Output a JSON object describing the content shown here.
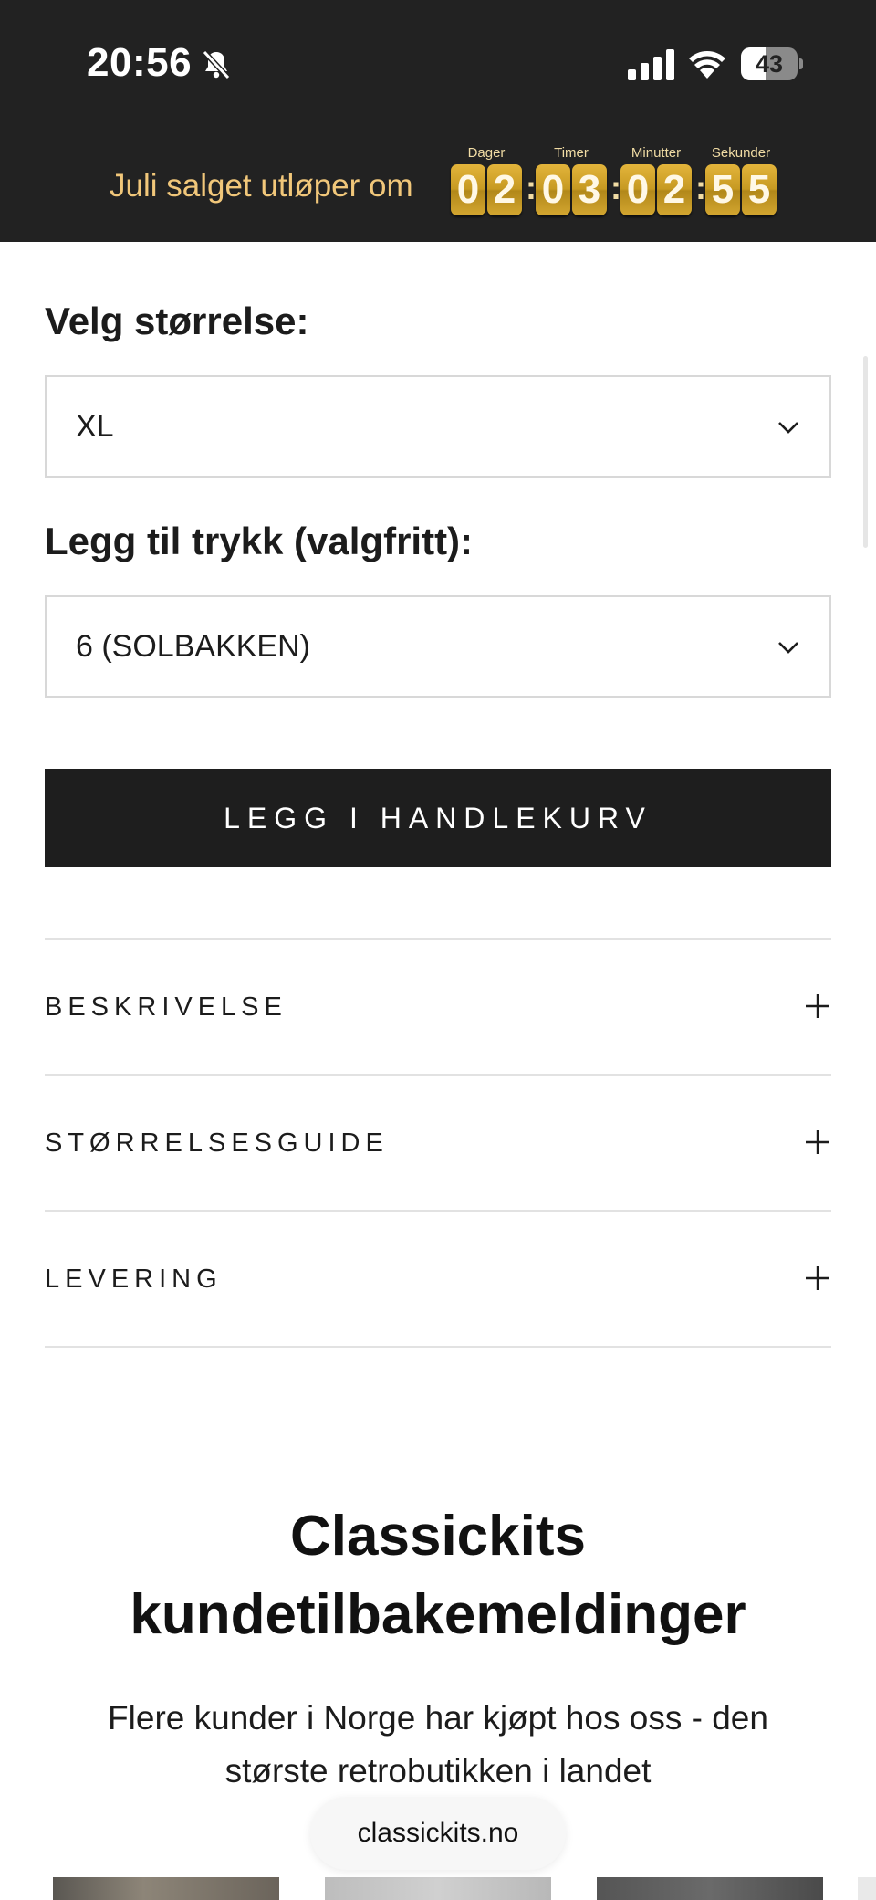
{
  "status_bar": {
    "time": "20:56",
    "battery_level": "43",
    "battery_fraction": 0.43,
    "icons": [
      "bell-muted-icon",
      "cellular-signal-icon",
      "wifi-icon",
      "battery-icon"
    ]
  },
  "promo_bar": {
    "text": "Juli salget utløper om",
    "countdown": {
      "days_label": "Dager",
      "days": [
        "0",
        "2"
      ],
      "hours_label": "Timer",
      "hours": [
        "0",
        "3"
      ],
      "minutes_label": "Minutter",
      "minutes": [
        "0",
        "2"
      ],
      "seconds_label": "Sekunder",
      "seconds": [
        "5",
        "5"
      ],
      "separator": ":"
    },
    "colors": {
      "background": "#222222",
      "text": "#f1c77a",
      "digit": "#d4a52c"
    }
  },
  "size_select": {
    "label": "Velg størrelse:",
    "value": "XL"
  },
  "print_select": {
    "label": "Legg til trykk (valgfritt):",
    "value": "6 (SOLBAKKEN)"
  },
  "add_to_cart": {
    "label": "LEGG I HANDLEKURV"
  },
  "accordion": [
    {
      "label": "BESKRIVELSE",
      "icon": "plus-icon"
    },
    {
      "label": "STØRRELSESGUIDE",
      "icon": "plus-icon"
    },
    {
      "label": "LEVERING",
      "icon": "plus-icon"
    }
  ],
  "reviews": {
    "title_line1": "Classickits",
    "title_line2": "kundetilbakemeldinger",
    "subtitle": "Flere kunder i Norge har kjøpt hos oss - den største retrobutikken i landet"
  },
  "browser": {
    "domain": "classickits.no"
  }
}
